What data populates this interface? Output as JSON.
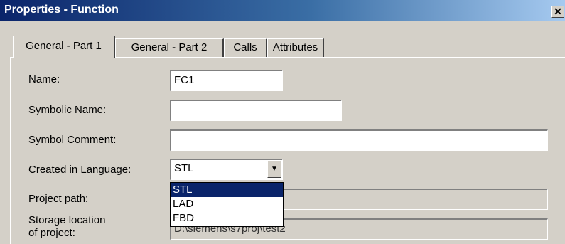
{
  "window": {
    "title": "Properties - Function",
    "close_symbol": "✕"
  },
  "tabs": [
    {
      "label": "General - Part 1",
      "active": true
    },
    {
      "label": "General - Part 2",
      "active": false
    },
    {
      "label": "Calls",
      "active": false
    },
    {
      "label": "Attributes",
      "active": false
    }
  ],
  "form": {
    "name": {
      "label": "Name:",
      "value": "FC1"
    },
    "symbolic_name": {
      "label": "Symbolic Name:",
      "value": ""
    },
    "symbol_comment": {
      "label": "Symbol Comment:",
      "value": ""
    },
    "language": {
      "label": "Created in Language:",
      "value": "STL",
      "arrow": "▼"
    },
    "project_path": {
      "label": "Project path:",
      "value": ""
    },
    "storage_location": {
      "label_line1": "Storage location",
      "label_line2": "of project:",
      "value": "D:\\siemens\\s7proj\\test2"
    }
  },
  "language_dropdown": {
    "options": [
      "STL",
      "LAD",
      "FBD"
    ],
    "selected": "STL"
  }
}
